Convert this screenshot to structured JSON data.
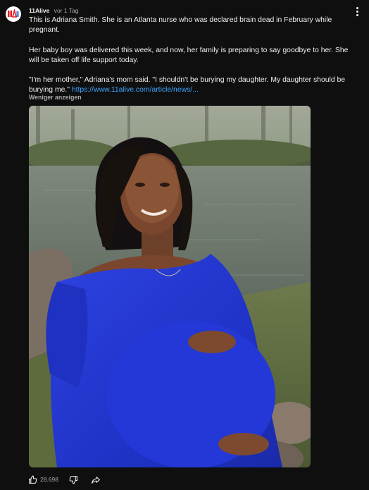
{
  "channel": {
    "name": "11Alive",
    "time": "vor 1 Tag",
    "avatar_icon": "11alive-logo"
  },
  "post": {
    "paragraphs": [
      "This is Adriana Smith. She is an Atlanta nurse who was declared brain dead in February while pregnant.",
      "Her baby boy was delivered this week, and now, her family is preparing to say goodbye to her. She will be taken off life support today."
    ],
    "quote_text": "\"I'm her mother,\" Adriana's mom said. \"I shouldn't be burying my daughter. My daughter should be burying me.\" ",
    "link_text": "https://www.11alive.com/article/news/...",
    "show_less": "Weniger anzeigen"
  },
  "actions": {
    "like_count": "28.698",
    "like_icon": "thumbs-up-icon",
    "dislike_icon": "thumbs-down-icon",
    "share_icon": "share-icon"
  },
  "colors": {
    "background": "#0f0f0f",
    "text": "#f1f1f1",
    "secondary_text": "#aaaaaa",
    "link": "#3ea6ff",
    "brand_red": "#e21b23"
  }
}
